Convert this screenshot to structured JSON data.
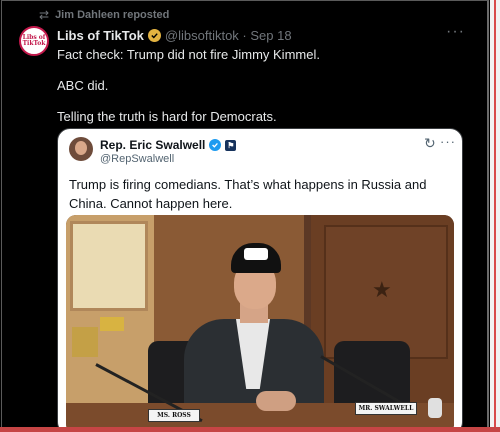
{
  "repost": {
    "label": "Jim Dahleen reposted",
    "icon": "repost-icon"
  },
  "post": {
    "author_name": "Libs of TikTok",
    "handle_date": "@libsoftiktok · Sep 18",
    "avatar_text": "Libs of TikTok",
    "lines": [
      "Fact check: Trump did not fire Jimmy Kimmel.",
      "ABC did.",
      "Telling the truth is hard for Democrats."
    ],
    "more": "···"
  },
  "quote": {
    "author_name": "Rep. Eric Swalwell",
    "handle": "@RepSwalwell",
    "flag": "⚑",
    "text": "Trump is firing comedians. That’s what happens in Russia and China. Cannot happen here.",
    "more": "···",
    "refresh": "↻",
    "media": {
      "plate_left": "MS. ROSS",
      "plate_right": "MR. SWALWELL"
    }
  },
  "colors": {
    "accent_gold": "#e3b341",
    "accent_blue": "#1d9bf0",
    "background": "#000000"
  }
}
